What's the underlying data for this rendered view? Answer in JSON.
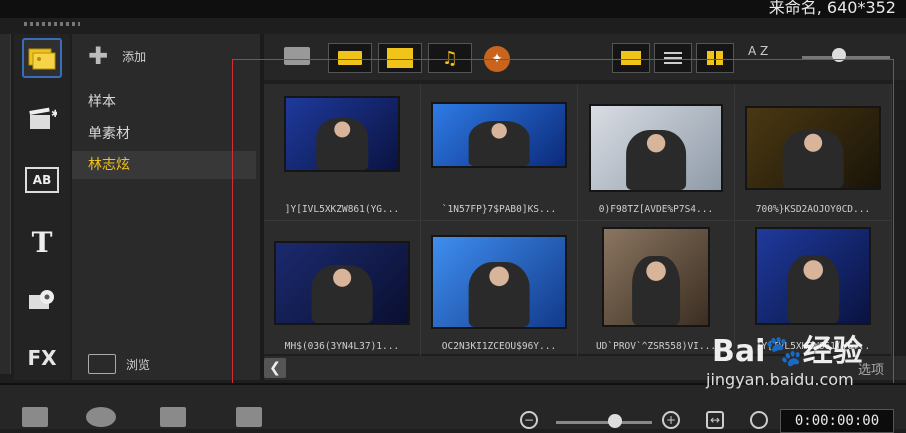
{
  "window": {
    "title_fragment": "来命名, 640*352"
  },
  "library_tabs": [
    {
      "name": "media",
      "glyph": "▦"
    },
    {
      "name": "instant-project",
      "glyph": "✚"
    },
    {
      "name": "transition",
      "glyph": "AB"
    },
    {
      "name": "title",
      "glyph": "T"
    },
    {
      "name": "graphics",
      "glyph": "✿"
    },
    {
      "name": "filter",
      "glyph": "FX"
    }
  ],
  "sidebar": {
    "add_label": "添加",
    "items": [
      {
        "label": "样本"
      },
      {
        "label": "单素材"
      },
      {
        "label": "林志炫",
        "selected": true
      }
    ],
    "browse_label": "浏览"
  },
  "toolbar": {
    "icons": [
      "folder-icon",
      "video-filter-icon",
      "photo-filter-icon",
      "audio-filter-icon",
      "transition-icon"
    ],
    "view_icons": [
      "list-large-icon",
      "list-details-icon",
      "thumbnail-icon"
    ],
    "sort_label": "A Z"
  },
  "media_items": [
    {
      "caption": "]Y[IVL5XKZW861(YG...",
      "colors": [
        "#1e3a9c",
        "#0a1240"
      ]
    },
    {
      "caption": "`1N57FP}7$PAB0]KS...",
      "colors": [
        "#2f7be6",
        "#0b2a7a"
      ]
    },
    {
      "caption": "0)F98TZ[AVDE%P7S4...",
      "colors": [
        "#d9dde3",
        "#8f9aa8"
      ]
    },
    {
      "caption": "700%}KSD2AOJOY0CD...",
      "colors": [
        "#4a3812",
        "#1a1408"
      ]
    },
    {
      "caption": "MH$(036(3YN4L37)1...",
      "colors": [
        "#1b2a6e",
        "#0a0f30"
      ]
    },
    {
      "caption": "OC2N3KI1ZCEOU$96Y...",
      "colors": [
        "#3f8ef0",
        "#123a8a"
      ]
    },
    {
      "caption": "UD`PROV`^ZSR558)VI...",
      "colors": [
        "#8a7560",
        "#3b2e22"
      ]
    },
    {
      "caption": "]Y[IVL5XKZW861(YG...",
      "colors": [
        "#1e3a9c",
        "#0a1240"
      ]
    }
  ],
  "bottom_panel": {
    "options_label": "选项"
  },
  "timeline": {
    "timecode": "0:00:00:00"
  },
  "watermark": {
    "brand_left": "Bai",
    "brand_right": "经验",
    "url": "jingyan.baidu.com"
  }
}
